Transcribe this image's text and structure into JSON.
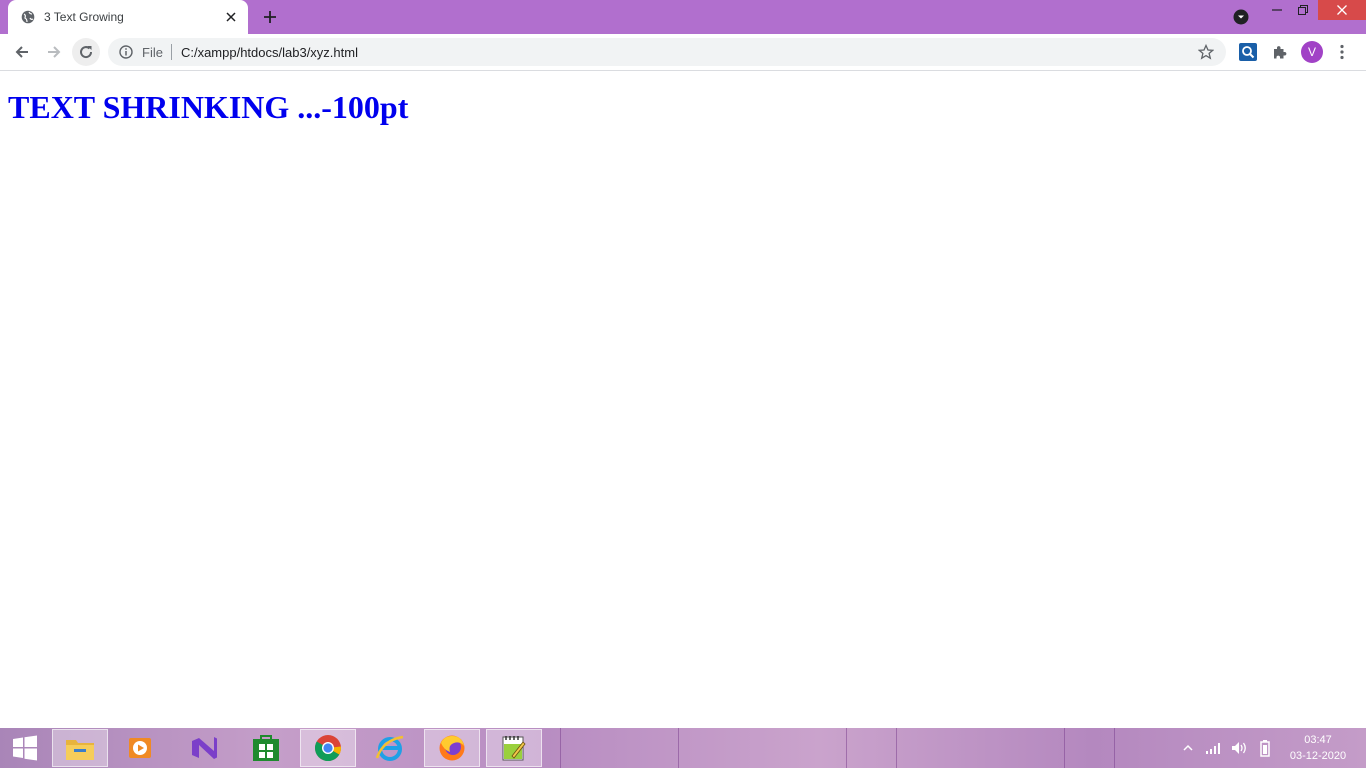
{
  "window": {
    "tab_title": "3 Text Growing",
    "accent_color": "#b16fce",
    "close_color": "#d74a4a"
  },
  "toolbar": {
    "scheme_label": "File",
    "url": "C:/xampp/htdocs/lab3/xyz.html",
    "avatar_letter": "V"
  },
  "page": {
    "heading": "TEXT SHRINKING ...-100pt",
    "heading_color": "#0000ee"
  },
  "taskbar": {
    "time": "03:47",
    "date": "03-12-2020",
    "apps": [
      "start-icon",
      "file-explorer-icon",
      "media-player-icon",
      "visual-studio-icon",
      "store-icon",
      "chrome-icon",
      "internet-explorer-icon",
      "firefox-icon",
      "notepad-plus-icon"
    ]
  }
}
